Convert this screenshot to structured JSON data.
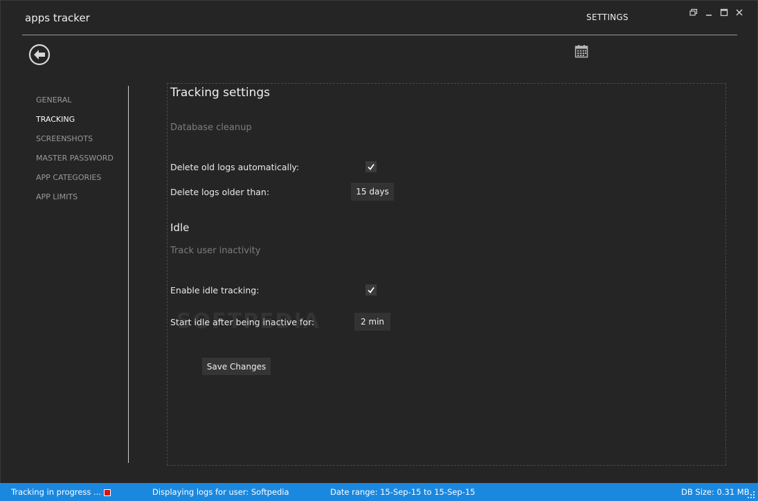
{
  "window": {
    "app_title": "apps tracker",
    "page_title": "SETTINGS",
    "controls": [
      {
        "name": "restore-icon"
      },
      {
        "name": "minimize-icon"
      },
      {
        "name": "maximize-icon"
      },
      {
        "name": "close-icon"
      }
    ]
  },
  "toolbar": {
    "back_icon": "arrow-left-circle-icon",
    "calendar_icon": "calendar-icon"
  },
  "nav": {
    "items": [
      {
        "label": "GENERAL",
        "active": false
      },
      {
        "label": "TRACKING",
        "active": true
      },
      {
        "label": "SCREENSHOTS",
        "active": false
      },
      {
        "label": "MASTER PASSWORD",
        "active": false
      },
      {
        "label": "APP CATEGORIES",
        "active": false
      },
      {
        "label": "APP LIMITS",
        "active": false
      }
    ]
  },
  "main": {
    "title": "Tracking settings",
    "cleanup": {
      "subtitle": "Database cleanup",
      "auto_delete_label": "Delete old logs automatically:",
      "auto_delete_checked": true,
      "older_than_label": "Delete logs older than:",
      "older_than_value": "15 days"
    },
    "idle": {
      "heading": "Idle",
      "subtitle": "Track user inactivity",
      "enable_label": "Enable idle tracking:",
      "enable_checked": true,
      "inactive_label": "Start idle after being inactive for:",
      "inactive_value": "2 min"
    },
    "save_label": "Save Changes",
    "watermark": "SOFTPEDIA"
  },
  "status": {
    "tracking": "Tracking in progress ...",
    "user": "Displaying logs for user: Softpedia",
    "date_range": "Date range: 15-Sep-15 to 15-Sep-15",
    "db_size": "DB Size: 0.31 MB"
  },
  "colors": {
    "background": "#252525",
    "statusbar": "#1b88e0",
    "recording": "#e01010"
  }
}
